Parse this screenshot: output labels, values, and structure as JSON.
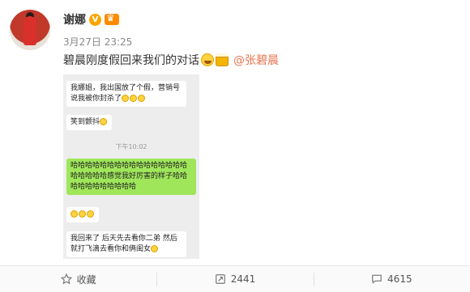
{
  "author": {
    "name": "谢娜",
    "verified_mark": "V"
  },
  "meta": {
    "timestamp": "3月27日 23:25"
  },
  "post": {
    "text": "碧晨刚度假回来我们的对话",
    "mention": "@张碧晨"
  },
  "chat": {
    "messages": [
      {
        "side": "left",
        "text": "我娜姐，我出国放了个假，营销号说我被你封杀了"
      },
      {
        "side": "left",
        "text": "笑到颤抖"
      },
      {
        "side": "time",
        "text": "下午10:02"
      },
      {
        "side": "right",
        "text": "哈哈哈哈哈哈哈哈哈哈哈哈哈哈哈哈哈哈哈哈哈感觉我好厉害的样子哈哈哈哈哈哈哈哈哈哈哈"
      },
      {
        "side": "left",
        "text": ""
      },
      {
        "side": "left",
        "text": "我回来了 后天先去看你二弟 然后就打飞滴去看你和俩闺女"
      }
    ]
  },
  "toolbar": {
    "favorite_label": "收藏",
    "repost_count": "2441",
    "comment_count": "4615"
  },
  "icons": [
    "star-icon",
    "repost-icon",
    "comment-icon",
    "laugh-emoji-icon",
    "beer-icon",
    "crown-icon"
  ],
  "colors": {
    "mention": "#eb7350",
    "chat_right_bubble": "#9fe65a",
    "verified": "#f7a600"
  }
}
